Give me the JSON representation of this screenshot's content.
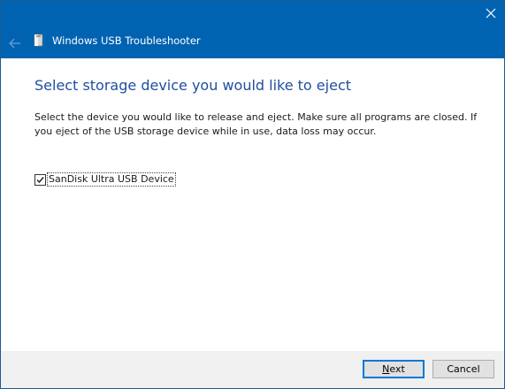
{
  "window": {
    "title": "Windows USB Troubleshooter",
    "icons": {
      "back": "back-arrow-icon",
      "close": "close-icon",
      "app": "usb-drive-icon"
    },
    "colors": {
      "titlebar": "#0063b1",
      "heading": "#1f4e9e",
      "footer": "#f0f0f0"
    }
  },
  "main": {
    "heading": "Select storage device you would like to eject",
    "description": "Select the device you would like to release and eject. Make sure all programs are closed. If you eject of the USB storage device while in use, data loss may occur.",
    "devices": [
      {
        "label": "SanDisk Ultra USB Device",
        "checked": true
      }
    ]
  },
  "footer": {
    "next_label_accel": "N",
    "next_label_rest": "ext",
    "cancel_label": "Cancel"
  }
}
